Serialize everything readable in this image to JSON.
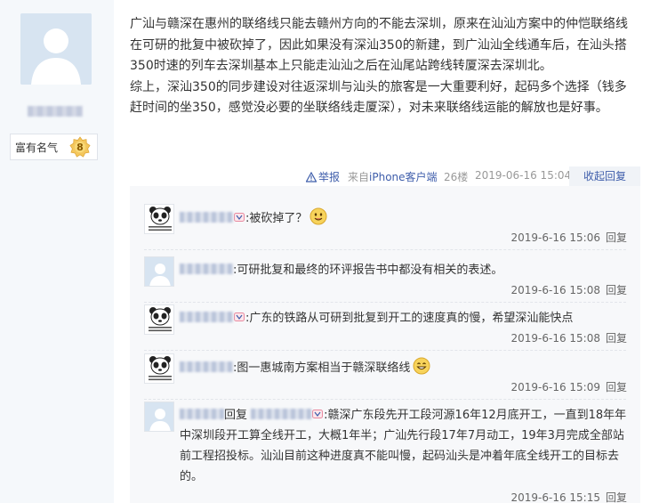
{
  "author": {
    "avatar_icon": "default-avatar-icon",
    "badge_label": "富有名气",
    "badge_level": "8"
  },
  "post": {
    "paragraphs": [
      "广汕与赣深在惠州的联络线只能去赣州方向的不能去深圳，原来在汕汕方案中的仲恺联络线在可研的批复中被砍掉了，因此如果没有深汕350的新建，到广汕汕全线通车后，在汕头搭350时速的列车去深圳基本上只能走汕汕之后在汕尾站跨线转厦深去深圳北。",
      "综上，深汕350的同步建设对往返深圳与汕头的旅客是一大重要利好，起码多个选择（钱多赶时间的坐350，感觉没必要的坐联络线走厦深），对未来联络线运能的解放也是好事。"
    ]
  },
  "meta": {
    "report_label": "举报",
    "source_prefix": "来自",
    "source_device": "iPhone客户端",
    "floor": "26楼",
    "time": "2019-06-16 15:04",
    "collapse_label": "收起回复"
  },
  "replies": [
    {
      "avatar": "panda-avatar-icon",
      "text": "被砍掉了？",
      "emoji": "smile-emoji-icon",
      "time": "2019-6-16 15:06",
      "reply_label": "回复"
    },
    {
      "avatar": "default-avatar-icon",
      "text": "可研批复和最终的环评报告书中都没有相关的表述。",
      "time": "2019-6-16 15:08",
      "reply_label": "回复"
    },
    {
      "avatar": "panda-avatar-icon",
      "text": "广东的铁路从可研到批复到开工的速度真的慢，希望深汕能快点",
      "time": "2019-6-16 15:08",
      "reply_label": "回复"
    },
    {
      "avatar": "panda-avatar-icon",
      "text": "图一惠城南方案相当于赣深联络线",
      "emoji": "grin-emoji-icon",
      "time": "2019-6-16 15:09",
      "reply_label": "回复"
    },
    {
      "avatar": "default-avatar-icon",
      "reply_word": "回复",
      "text": "赣深广东段先开工段河源16年12月底开工，一直到18年年中深圳段开工算全线开工，大概1年半；广汕先行段17年7月动工，19年3月完成全部站前工程招投标。汕汕目前这种进度真不能叫慢，起码汕头是冲着年底全线开工的目标去的。",
      "time": "2019-6-16 15:15",
      "reply_label": "回复"
    }
  ]
}
